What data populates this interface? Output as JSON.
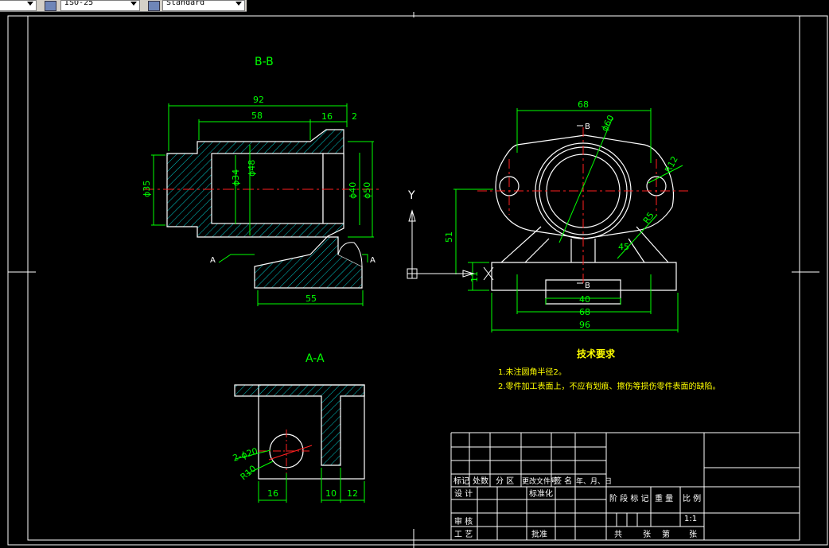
{
  "toolbar": {
    "dimstyle": "ISO-25",
    "textstyle": "Standard"
  },
  "drawing": {
    "section_bb": "B-B",
    "section_aa": "A-A",
    "dims_bb": {
      "d92": "92",
      "d58": "58",
      "d16": "16",
      "d2": "2",
      "d35": "ϕ35",
      "d34": "ϕ34",
      "d48": "ϕ48",
      "d40": "ϕ40",
      "d50": "ϕ50",
      "d55": "55",
      "a_left": "A",
      "a_right": "A"
    },
    "dims_top": {
      "d68top": "68",
      "d60": "ϕ60",
      "r12": "R12",
      "b_top": "B",
      "b_bot": "B",
      "r5": "R5",
      "d45": "45",
      "d51": "51",
      "d11": "11",
      "d40": "40",
      "d68": "68",
      "d96": "96"
    },
    "dims_aa": {
      "d2_20": "2-ϕ20",
      "r10": "R10",
      "d16": "16",
      "d10": "10",
      "d12": "12"
    },
    "axis": {
      "y": "Y"
    },
    "notes": {
      "title": "技术要求",
      "line1": "1.未注圆角半径2。",
      "line2": "2.零件加工表面上，不应有划痕、擦伤等损伤零件表面的缺陷。"
    },
    "title_block": {
      "col_mark": "标记",
      "col_count": "处数",
      "col_zone": "分 区",
      "col_docno": "更改文件号",
      "col_sign": "签 名",
      "col_date": "年、月、日",
      "design": "设 计",
      "standard": "标准化",
      "review": "审 核",
      "process": "工 艺",
      "approve": "批准",
      "stage": "阶 段 标 记",
      "weight": "重 量",
      "scale": "比 例",
      "scale_val": "1:1",
      "sheets_total": "共",
      "sheets": "张",
      "sheet_no": "第",
      "sheet_end": "张"
    }
  }
}
